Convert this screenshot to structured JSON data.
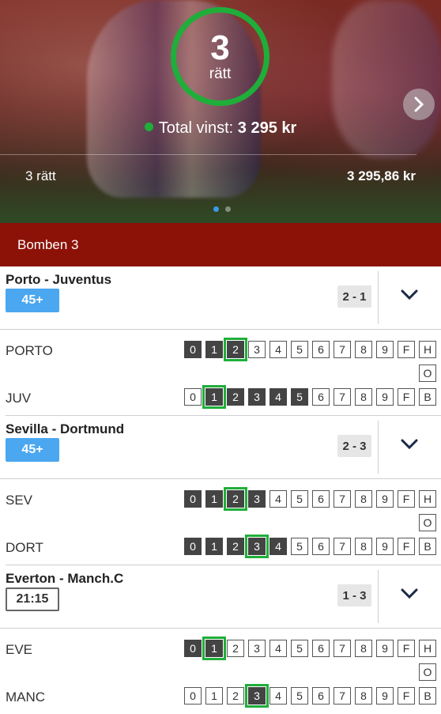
{
  "hero": {
    "correct_number": "3",
    "correct_unit": "rätt",
    "total_label": "Total vinst:",
    "total_value": "3 295 kr",
    "row_label": "3 rätt",
    "row_value": "3 295,86 kr",
    "accent_color": "#1fae3a"
  },
  "section": {
    "title": "Bomben 3"
  },
  "matches": [
    {
      "title": "Porto - Juventus",
      "badge": "45+",
      "badge_type": "live",
      "score": "2 - 1",
      "home": {
        "name": "PORTO",
        "cells": [
          "0",
          "1",
          "2",
          "3",
          "4",
          "5",
          "6",
          "7",
          "8",
          "9",
          "F",
          "H"
        ],
        "filled": [
          0,
          1,
          2
        ],
        "marked": [
          2
        ],
        "extra": "O"
      },
      "away": {
        "name": "JUV",
        "cells": [
          "0",
          "1",
          "2",
          "3",
          "4",
          "5",
          "6",
          "7",
          "8",
          "9",
          "F",
          "B"
        ],
        "filled": [
          1,
          2,
          3,
          4,
          5
        ],
        "marked": [
          1
        ]
      }
    },
    {
      "title": "Sevilla - Dortmund",
      "badge": "45+",
      "badge_type": "live",
      "score": "2 - 3",
      "home": {
        "name": "SEV",
        "cells": [
          "0",
          "1",
          "2",
          "3",
          "4",
          "5",
          "6",
          "7",
          "8",
          "9",
          "F",
          "H"
        ],
        "filled": [
          0,
          1,
          2,
          3
        ],
        "marked": [
          2
        ],
        "extra": "O"
      },
      "away": {
        "name": "DORT",
        "cells": [
          "0",
          "1",
          "2",
          "3",
          "4",
          "5",
          "6",
          "7",
          "8",
          "9",
          "F",
          "B"
        ],
        "filled": [
          0,
          1,
          2,
          3,
          4
        ],
        "marked": [
          3
        ]
      }
    },
    {
      "title": "Everton - Manch.C",
      "badge": "21:15",
      "badge_type": "time",
      "score": "1 - 3",
      "home": {
        "name": "EVE",
        "cells": [
          "0",
          "1",
          "2",
          "3",
          "4",
          "5",
          "6",
          "7",
          "8",
          "9",
          "F",
          "H"
        ],
        "filled": [
          0,
          1
        ],
        "marked": [
          1
        ],
        "extra": "O"
      },
      "away": {
        "name": "MANC",
        "cells": [
          "0",
          "1",
          "2",
          "3",
          "4",
          "5",
          "6",
          "7",
          "8",
          "9",
          "F",
          "B"
        ],
        "filled": [
          3
        ],
        "marked": [
          3
        ]
      }
    }
  ]
}
